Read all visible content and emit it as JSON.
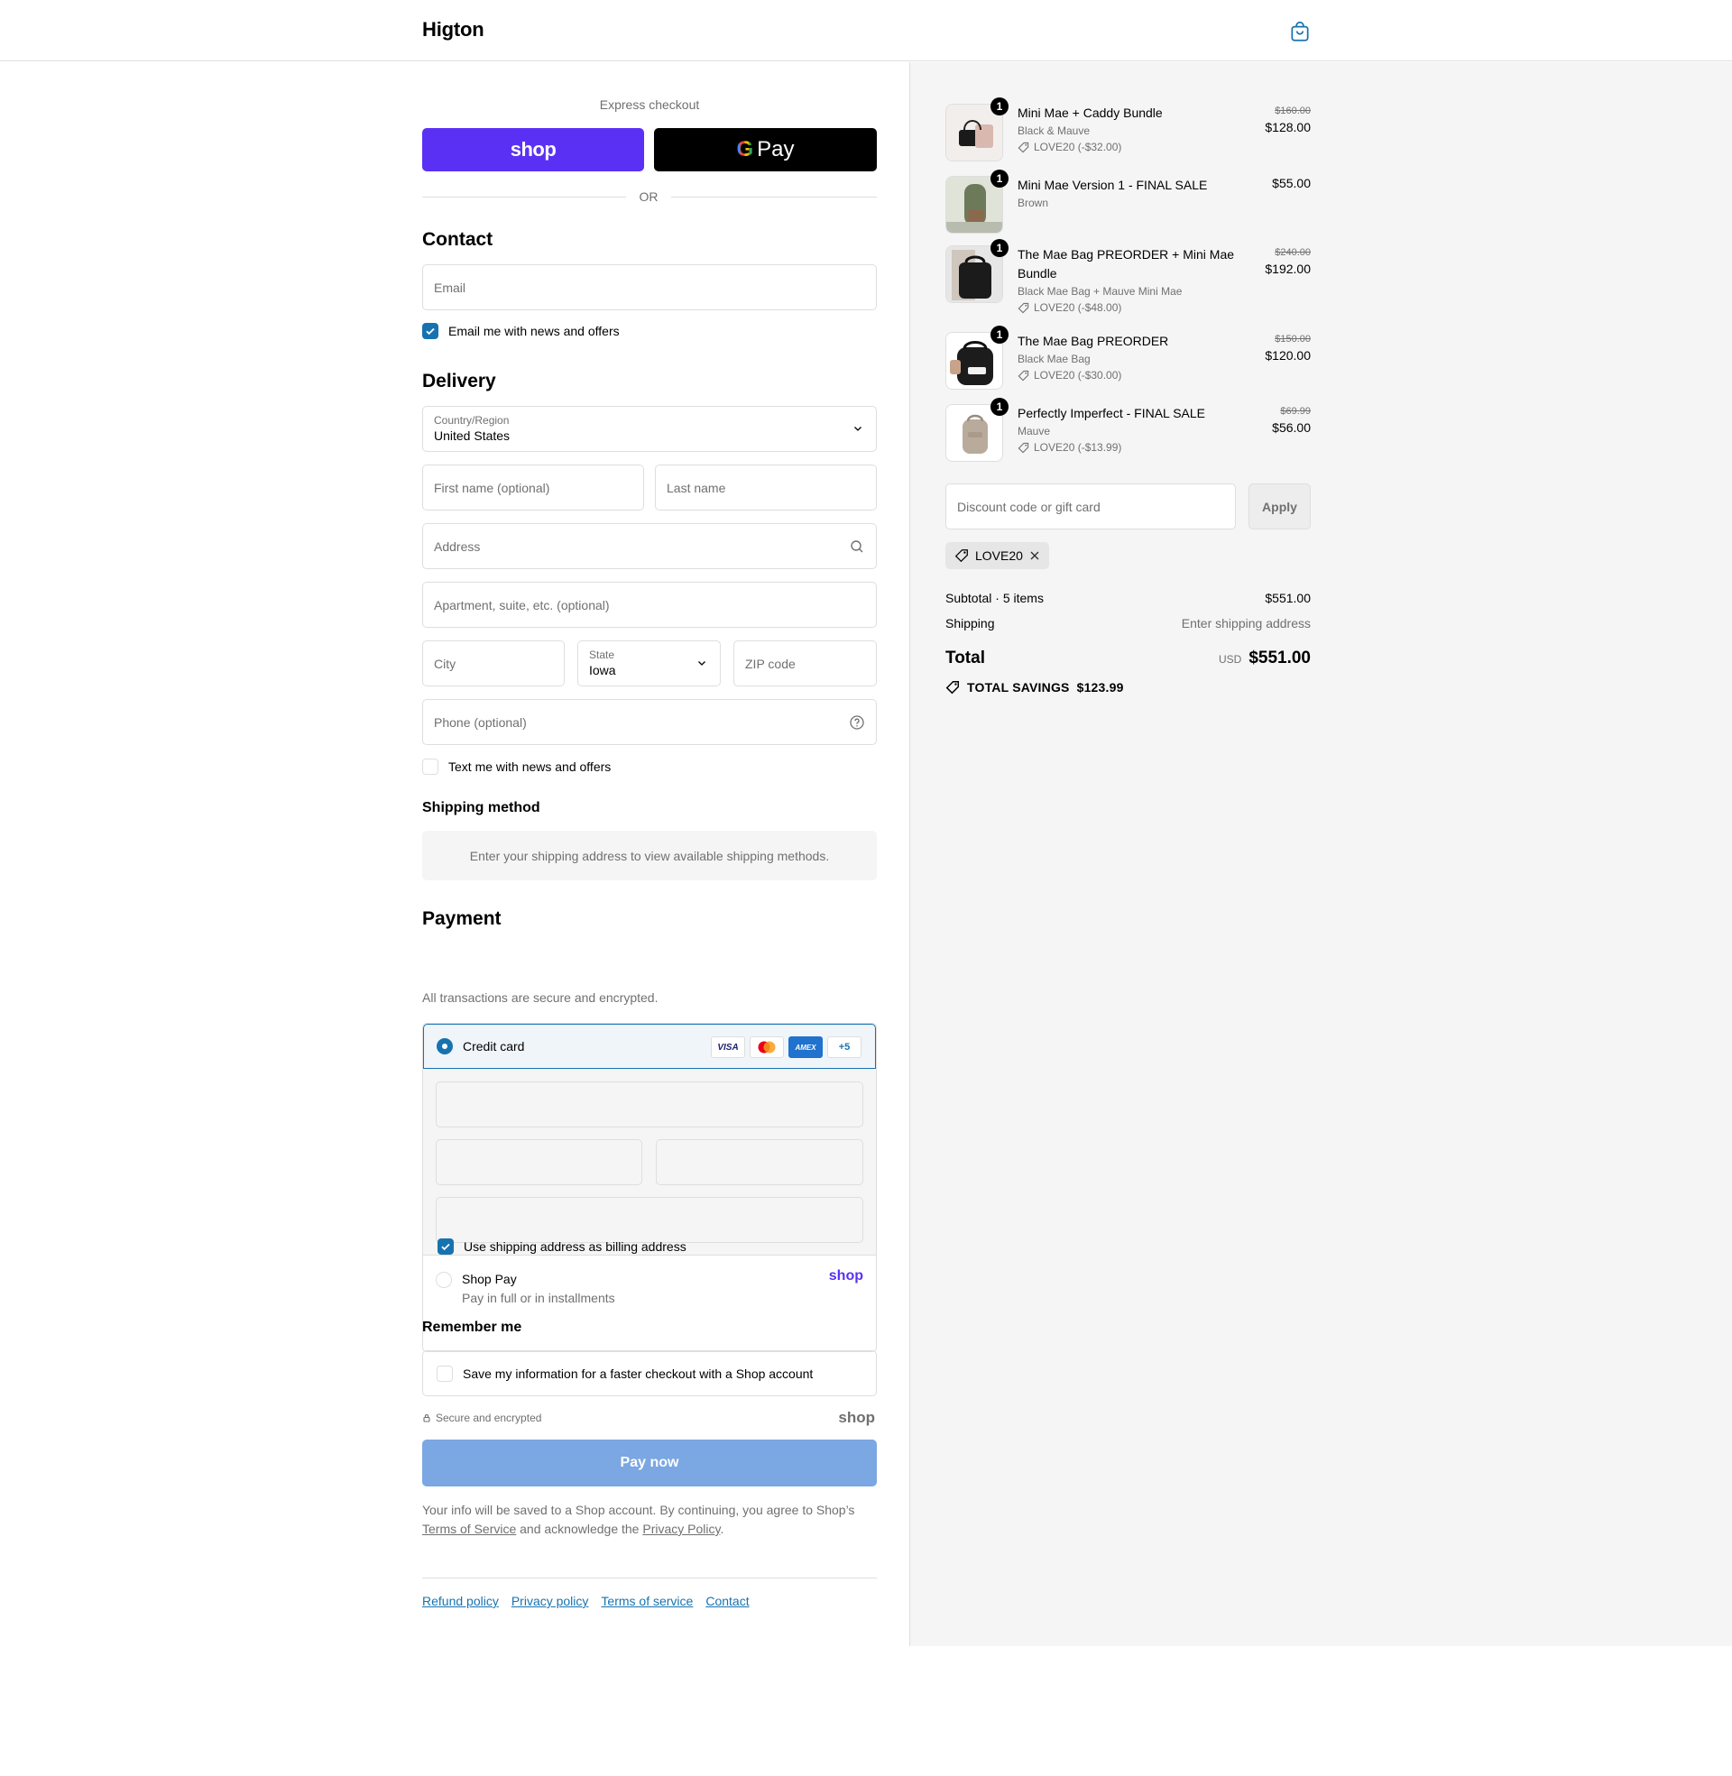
{
  "header": {
    "brand": "Higton",
    "cart_icon": "shopping-bag-icon"
  },
  "express": {
    "label": "Express checkout",
    "shop_label": "shop",
    "gpay_g": "G",
    "gpay_label": "Pay",
    "or": "OR"
  },
  "contact": {
    "heading": "Contact",
    "email_placeholder": "Email",
    "news_label": "Email me with news and offers",
    "news_checked": true
  },
  "delivery": {
    "heading": "Delivery",
    "country_label": "Country/Region",
    "country_value": "United States",
    "first_placeholder": "First name (optional)",
    "last_placeholder": "Last name",
    "address_placeholder": "Address",
    "apt_placeholder": "Apartment, suite, etc. (optional)",
    "city_placeholder": "City",
    "state_label": "State",
    "state_value": "Iowa",
    "zip_placeholder": "ZIP code",
    "phone_placeholder": "Phone (optional)",
    "text_label": "Text me with news and offers",
    "text_checked": false
  },
  "shipping_method": {
    "heading": "Shipping method",
    "info": "Enter your shipping address to view available shipping methods."
  },
  "payment": {
    "heading": "Payment",
    "subtitle": "All transactions are secure and encrypted.",
    "credit_card_label": "Credit card",
    "card_logos": [
      "VISA",
      "mastercard",
      "AMEX",
      "+5"
    ],
    "billing_label": "Use shipping address as billing address",
    "shoppay_title": "Shop Pay",
    "shoppay_sub": "Pay in full or in installments",
    "shoppay_logo": "shop"
  },
  "remember": {
    "heading": "Remember me",
    "save_label": "Save my information for a faster checkout with a Shop account"
  },
  "secure": {
    "label": "Secure and encrypted",
    "shop_logo": "shop"
  },
  "pay_now": "Pay now",
  "legal": {
    "pre": "Your info will be saved to a Shop account. By continuing, you agree to Shop’s ",
    "tos": "Terms of Service",
    "mid": " and acknowledge the ",
    "privacy": "Privacy Policy",
    "post": "."
  },
  "footer_links": [
    "Refund policy",
    "Privacy policy",
    "Terms of service",
    "Contact"
  ],
  "items": [
    {
      "qty": "1",
      "name": "Mini Mae + Caddy Bundle",
      "variant": "Black & Mauve",
      "discount": "LOVE20 (-$32.00)",
      "original": "$160.00",
      "price": "$128.00"
    },
    {
      "qty": "1",
      "name": "Mini Mae Version 1 - FINAL SALE",
      "variant": "Brown",
      "discount": "",
      "original": "",
      "price": "$55.00"
    },
    {
      "qty": "1",
      "name": "The Mae Bag PREORDER + Mini Mae Bundle",
      "variant": "Black Mae Bag + Mauve Mini Mae",
      "discount": "LOVE20 (-$48.00)",
      "original": "$240.00",
      "price": "$192.00"
    },
    {
      "qty": "1",
      "name": "The Mae Bag PREORDER",
      "variant": "Black Mae Bag",
      "discount": "LOVE20 (-$30.00)",
      "original": "$150.00",
      "price": "$120.00"
    },
    {
      "qty": "1",
      "name": "Perfectly Imperfect - FINAL SALE",
      "variant": "Mauve",
      "discount": "LOVE20 (-$13.99)",
      "original": "$69.99",
      "price": "$56.00"
    }
  ],
  "discount": {
    "placeholder": "Discount code or gift card",
    "apply": "Apply",
    "applied_code": "LOVE20"
  },
  "totals": {
    "subtotal_label": "Subtotal · 5 items",
    "subtotal_value": "$551.00",
    "shipping_label": "Shipping",
    "shipping_value": "Enter shipping address",
    "total_label": "Total",
    "currency": "USD",
    "total_value": "$551.00",
    "savings_label": "TOTAL SAVINGS",
    "savings_value": "$123.99"
  },
  "colors": {
    "accent": "#1773b0",
    "shop_purple": "#5a31f4",
    "pay_now_disabled": "#7ba7e2",
    "summary_bg": "#f5f5f5"
  }
}
